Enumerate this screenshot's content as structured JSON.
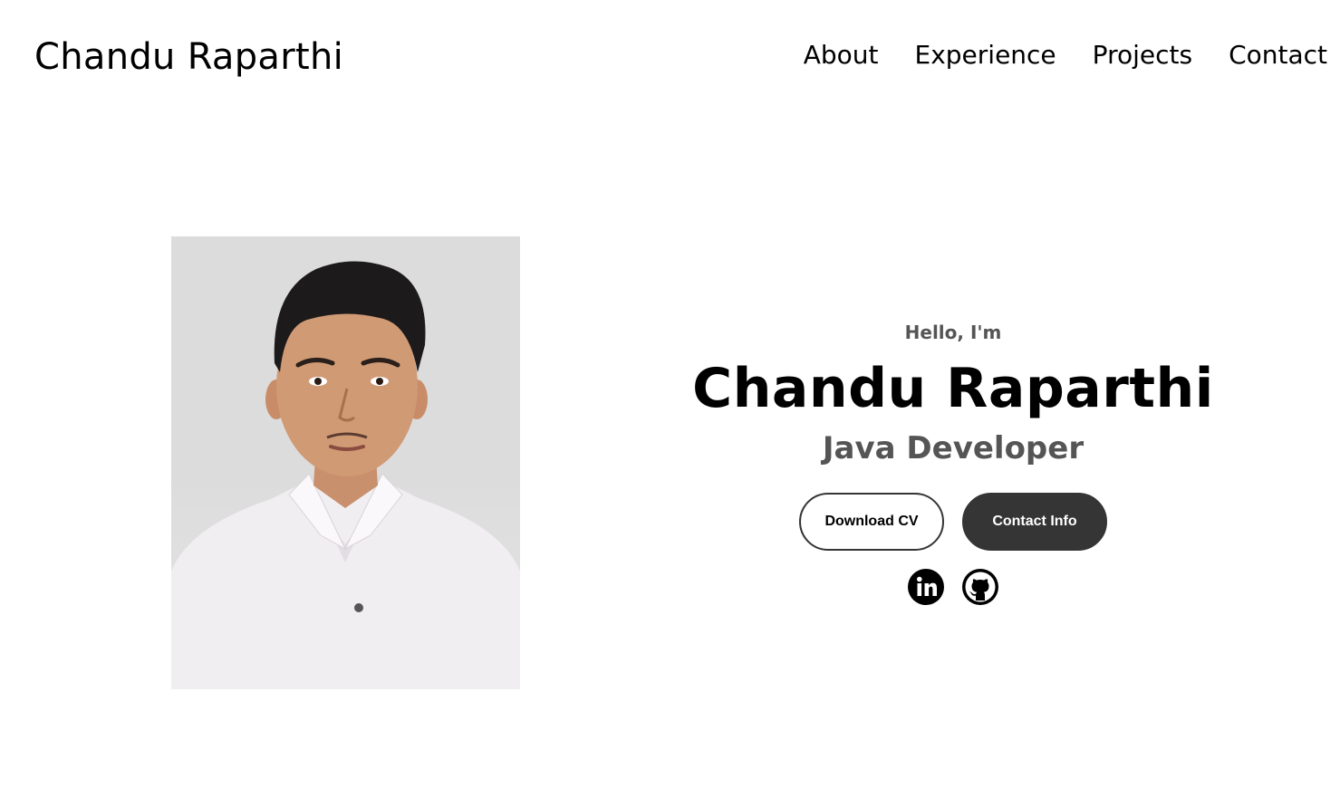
{
  "nav": {
    "logo": "Chandu Raparthi",
    "links": [
      "About",
      "Experience",
      "Projects",
      "Contact"
    ]
  },
  "hero": {
    "greeting": "Hello, I'm",
    "name": "Chandu Raparthi",
    "title": "Java Developer",
    "buttons": {
      "download_cv": "Download CV",
      "contact_info": "Contact Info"
    },
    "socials": [
      "linkedin-icon",
      "github-icon"
    ]
  },
  "colors": {
    "text": "#000000",
    "muted": "#555555",
    "button_dark": "#353535",
    "background": "#ffffff"
  }
}
